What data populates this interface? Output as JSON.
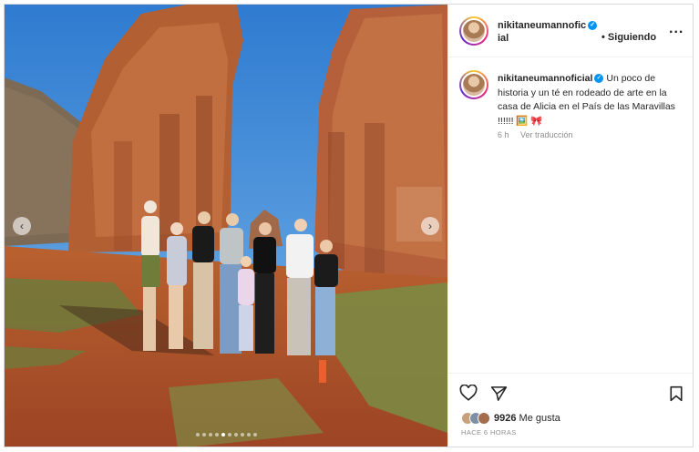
{
  "post": {
    "username_line1": "nikitaneumannofic",
    "username_line2": "ial",
    "username": "nikitaneumannoficial",
    "verified_icon": "verified-badge-icon",
    "follow_separator": "•",
    "follow_label": "Siguiendo",
    "more_label": "...",
    "caption": "Un poco de historia y un té en rodeado de arte en la casa de Alicia en el País de las Maravillas !!!!!! 🖼️ 🎀",
    "time": "6 h",
    "translate_label": "Ver traducción",
    "likes_count": "9926",
    "likes_label": "Me gusta",
    "posted_ago": "HACE 6 HORAS",
    "carousel": {
      "total": 10,
      "active_index": 4
    }
  },
  "icons": {
    "like": "heart-icon",
    "share": "send-icon",
    "save": "bookmark-icon",
    "prev": "chevron-left-icon",
    "next": "chevron-right-icon"
  },
  "colors": {
    "verified": "#0095f6",
    "sky": "#3b86d6",
    "ground": "#b4532a",
    "stone": "#b9693a"
  }
}
